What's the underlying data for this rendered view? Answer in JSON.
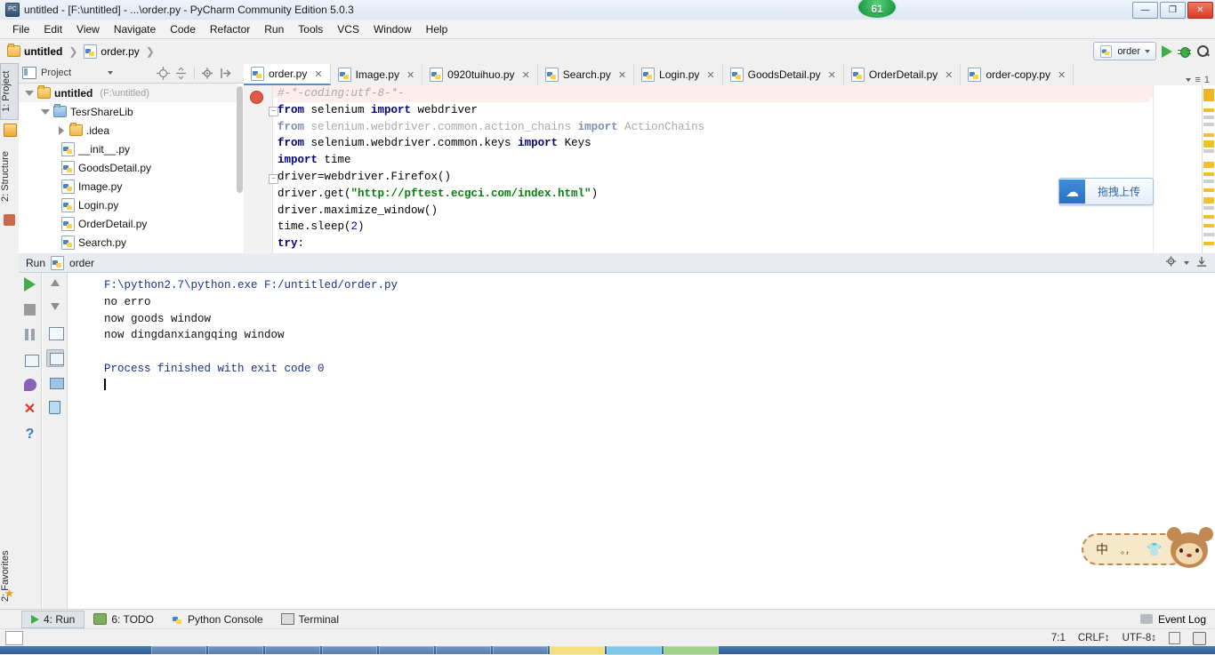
{
  "window": {
    "title": "untitled - [F:\\untitled] - ...\\order.py - PyCharm Community Edition 5.0.3",
    "app_icon": "PC",
    "minimize": "—",
    "maximize": "❐",
    "close": "✕",
    "badge_count": "61"
  },
  "menu": {
    "items": [
      {
        "label": "File"
      },
      {
        "label": "Edit"
      },
      {
        "label": "View"
      },
      {
        "label": "Navigate"
      },
      {
        "label": "Code"
      },
      {
        "label": "Refactor"
      },
      {
        "label": "Run"
      },
      {
        "label": "Tools"
      },
      {
        "label": "VCS"
      },
      {
        "label": "Window"
      },
      {
        "label": "Help"
      }
    ]
  },
  "navbar": {
    "breadcrumb": [
      {
        "label": "untitled",
        "icon": "folder-icon"
      },
      {
        "label": "order.py",
        "icon": "python-file-icon"
      }
    ],
    "run_config": "order",
    "run_button": "run-icon",
    "debug_button": "debug-bug-icon",
    "search_button": "search-icon"
  },
  "stripe": {
    "project": "1: Project",
    "structure": "2: Structure",
    "favorites": "2: Favorites"
  },
  "project_panel": {
    "title": "Project",
    "tree": [
      {
        "label": "untitled",
        "path": "(F:\\untitled)",
        "icon": "folder-icon",
        "arrow": "down",
        "indent": 1,
        "bold": true,
        "selected": true
      },
      {
        "label": "TesrShareLib",
        "path": "",
        "icon": "module-folder-icon",
        "arrow": "down",
        "indent": 2,
        "bold": false,
        "selected": false
      },
      {
        "label": ".idea",
        "path": "",
        "icon": "folder-icon",
        "arrow": "right",
        "indent": 3,
        "bold": false,
        "selected": false
      },
      {
        "label": "__init__.py",
        "path": "",
        "icon": "python-file-icon",
        "arrow": "none",
        "indent": 4,
        "bold": false,
        "selected": false
      },
      {
        "label": "GoodsDetail.py",
        "path": "",
        "icon": "python-file-icon",
        "arrow": "none",
        "indent": 4,
        "bold": false,
        "selected": false
      },
      {
        "label": "Image.py",
        "path": "",
        "icon": "python-file-icon",
        "arrow": "none",
        "indent": 4,
        "bold": false,
        "selected": false
      },
      {
        "label": "Login.py",
        "path": "",
        "icon": "python-file-icon",
        "arrow": "none",
        "indent": 4,
        "bold": false,
        "selected": false
      },
      {
        "label": "OrderDetail.py",
        "path": "",
        "icon": "python-file-icon",
        "arrow": "none",
        "indent": 4,
        "bold": false,
        "selected": false
      },
      {
        "label": "Search.py",
        "path": "",
        "icon": "python-file-icon",
        "arrow": "none",
        "indent": 4,
        "bold": false,
        "selected": false
      }
    ]
  },
  "editor": {
    "tabs": [
      {
        "label": "order.py",
        "active": true
      },
      {
        "label": "Image.py",
        "active": false
      },
      {
        "label": "0920tuihuo.py",
        "active": false
      },
      {
        "label": "Search.py",
        "active": false
      },
      {
        "label": "Login.py",
        "active": false
      },
      {
        "label": "GoodsDetail.py",
        "active": false
      },
      {
        "label": "OrderDetail.py",
        "active": false
      },
      {
        "label": "order-copy.py",
        "active": false
      }
    ],
    "tabs_overflow": "1",
    "code_lines": [
      {
        "text": "#-*-coding:utf-8-*-",
        "style": "comment",
        "highlight": true
      },
      {
        "text": "from selenium import webdriver",
        "style": "import",
        "fold": true
      },
      {
        "text": "from selenium.webdriver.common.action_chains import ActionChains",
        "style": "import-dim"
      },
      {
        "text": "from selenium.webdriver.common.keys import Keys",
        "style": "import"
      },
      {
        "text": "import time",
        "style": "import-plain",
        "fold": true
      },
      {
        "text": "driver=webdriver.Firefox()",
        "style": "plain"
      },
      {
        "text": "driver.get(\"http://pftest.ecgci.com/index.html\")",
        "style": "string-call"
      },
      {
        "text": "driver.maximize_window()",
        "style": "plain"
      },
      {
        "text": "time.sleep(2)",
        "style": "plain-num"
      },
      {
        "text": "try:",
        "style": "keyword"
      }
    ]
  },
  "baidu_widget": {
    "label": "拖拽上传",
    "logo": "baidu-cloud-icon"
  },
  "run_window": {
    "title": "Run",
    "config_name": "order",
    "settings_icon": "gear-icon",
    "minimize_icon": "hide-icon",
    "toolbar_left": [
      {
        "name": "rerun-button",
        "icon": "run-icon"
      },
      {
        "name": "stop-button",
        "icon": "stop-icon"
      },
      {
        "name": "pause-button",
        "icon": "pause-icon"
      },
      {
        "name": "toggle-console-button",
        "icon": "console-icon"
      },
      {
        "name": "pin-tab-button",
        "icon": "pin-icon"
      },
      {
        "name": "close-button",
        "icon": "close-x-icon"
      },
      {
        "name": "help-button",
        "icon": "question-icon"
      }
    ],
    "toolbar_right": [
      {
        "name": "scroll-up-button",
        "icon": "arrow-up-icon"
      },
      {
        "name": "scroll-down-button",
        "icon": "arrow-down-icon"
      },
      {
        "name": "soft-wrap-button",
        "icon": "wrap-icon"
      },
      {
        "name": "scroll-to-end-button",
        "icon": "scroll-end-icon"
      },
      {
        "name": "print-button",
        "icon": "printer-icon"
      },
      {
        "name": "clear-all-button",
        "icon": "trash-icon"
      }
    ],
    "output": [
      {
        "text": "F:\\python2.7\\python.exe F:/untitled/order.py",
        "color": "blue"
      },
      {
        "text": "no erro",
        "color": "black"
      },
      {
        "text": "now goods window",
        "color": "black"
      },
      {
        "text": "now dingdanxiangqing window",
        "color": "black"
      },
      {
        "text": "",
        "color": "black"
      },
      {
        "text": "Process finished with exit code 0",
        "color": "blue"
      }
    ]
  },
  "ime": {
    "mode": "中",
    "punctuation": "。，",
    "skin": "rilakkuma-bear-icon"
  },
  "bottom_bar": {
    "items": [
      {
        "label": "4: Run",
        "icon": "run-icon",
        "active": true
      },
      {
        "label": "6: TODO",
        "icon": "todo-icon",
        "active": false
      },
      {
        "label": "Python Console",
        "icon": "python-icon",
        "active": false
      },
      {
        "label": "Terminal",
        "icon": "terminal-icon",
        "active": false
      }
    ],
    "event_log": "Event Log"
  },
  "status_bar": {
    "caret_position": "7:1",
    "line_separator": "CRLF",
    "encoding": "UTF-8",
    "lock_icon": "lock-icon",
    "database_icon": "database-icon"
  },
  "colors": {
    "accent": "#4a90d9",
    "run_green": "#3fae47",
    "warning_marker": "#f2c029",
    "error_red": "#d0392b",
    "keyword_blue": "#000080",
    "string_green": "#048009"
  }
}
